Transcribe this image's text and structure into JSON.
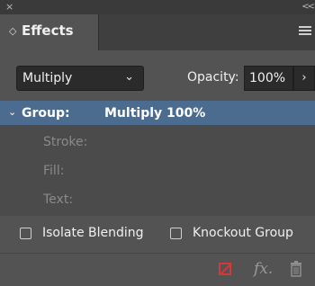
{
  "window": {
    "close_glyph": "×",
    "collapse_glyph": "<<"
  },
  "tab": {
    "label": "Effects",
    "chevron_glyph": "◇"
  },
  "blend": {
    "mode_value": "Multiply",
    "chevron_glyph": "⌄",
    "opacity_label": "Opacity:",
    "opacity_value": "100%",
    "opacity_button_glyph": "›"
  },
  "list": {
    "group": {
      "chevron_glyph": "⌄",
      "label": "Group:",
      "value": "Multiply 100%"
    },
    "items": [
      "Stroke:",
      "Fill:",
      "Text:"
    ]
  },
  "options": {
    "isolate_blending": "Isolate Blending",
    "knockout_group": "Knockout Group"
  },
  "footer": {
    "fx_glyph": "fx."
  },
  "colors": {
    "panel_bg": "#535353",
    "selection_bg": "#4b6c8f",
    "clear_icon": "#d23a3a"
  },
  "icons": [
    "close-icon",
    "collapse-icon",
    "panel-menu-icon",
    "clear-effects-icon",
    "fx-icon",
    "trash-icon"
  ]
}
